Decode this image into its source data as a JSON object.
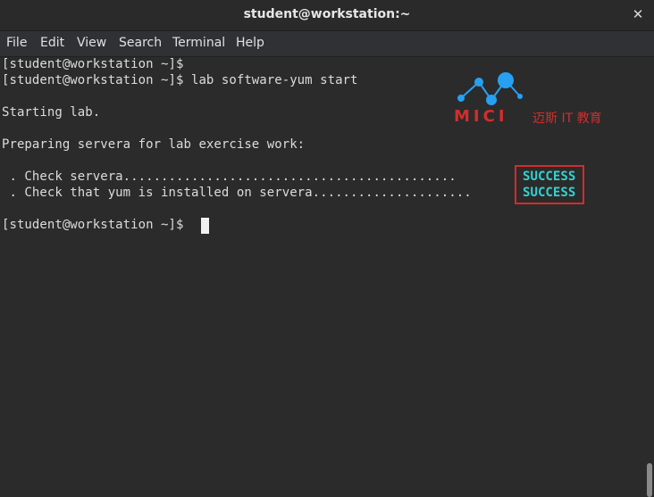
{
  "window": {
    "title": "student@workstation:~",
    "close_glyph": "✕"
  },
  "menubar": {
    "items": [
      "File",
      "Edit",
      "View",
      "Search",
      "Terminal",
      "Help"
    ]
  },
  "terminal": {
    "lines": [
      "[student@workstation ~]$",
      "[student@workstation ~]$ lab software-yum start",
      "",
      "Starting lab.",
      "",
      "Preparing servera for lab exercise work:",
      "",
      " . Check servera............................................",
      " . Check that yum is installed on servera.....................",
      "",
      "[student@workstation ~]$"
    ],
    "status": [
      "SUCCESS",
      "SUCCESS"
    ]
  },
  "logo": {
    "brand": "MICI",
    "subtitle": "迈斯 IT 教育",
    "accent_color": "#d42d2d",
    "node_color": "#27a0f2"
  },
  "colors": {
    "background": "#2b2b2b",
    "text": "#dcdcdc",
    "success": "#34d2d2",
    "highlight": "#d52b2b"
  }
}
